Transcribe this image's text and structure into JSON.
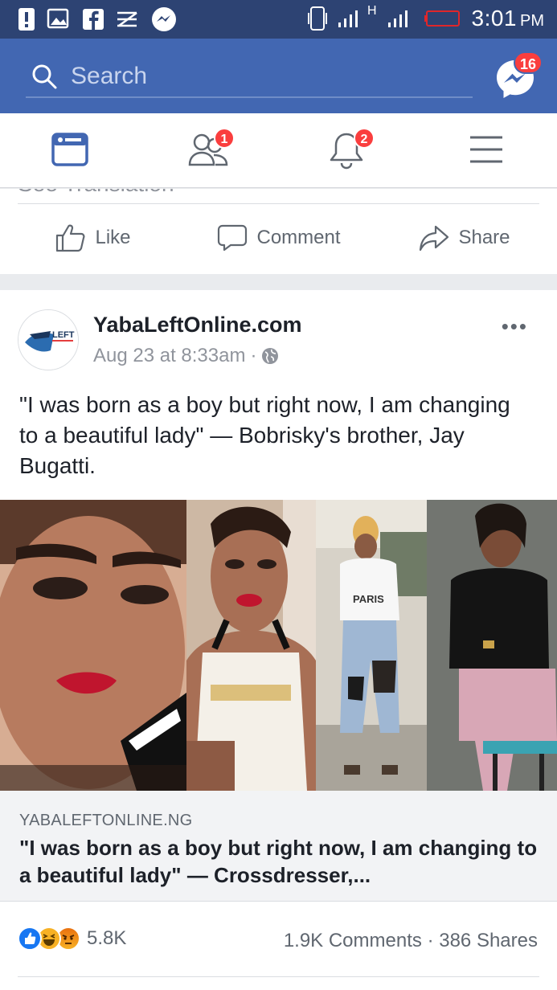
{
  "status_bar": {
    "time": "3:01",
    "ampm": "PM",
    "network": "H"
  },
  "search": {
    "placeholder": "Search"
  },
  "messenger": {
    "badge": "16"
  },
  "nav": {
    "friends_badge": "1",
    "notifications_badge": "2",
    "items": [
      "news-feed-icon",
      "friend-requests-icon",
      "notifications-icon",
      "menu-icon"
    ]
  },
  "previous_post": {
    "cut_text": "See Translation",
    "actions": {
      "like": "Like",
      "comment": "Comment",
      "share": "Share"
    }
  },
  "post": {
    "page_name": "YabaLeftOnline.com",
    "avatar_text": "LEFT",
    "timestamp": "Aug 23 at 8:33am",
    "separator": "·",
    "caption": "\"I was born as a boy but right now, I am changing to a beautiful lady\" — Bobrisky's brother, Jay Bugatti.",
    "photo_shirt_text": "PARIS",
    "link": {
      "domain": "YABALEFTONLINE.NG",
      "title": "\"I was born as a boy but right now, I am changing to a beautiful lady\" — Crossdresser,..."
    },
    "reaction_count": "5.8K",
    "comments": "1.9K Comments",
    "dot": "·",
    "shares": "386 Shares",
    "colors": {
      "facebook_blue": "#4267b2",
      "status_bar": "#2d4373",
      "badge_red": "#fa3e3e",
      "like_blue": "#1877f2",
      "haha_yellow": "#f7b125",
      "angry_orange": "#e9710f"
    }
  }
}
